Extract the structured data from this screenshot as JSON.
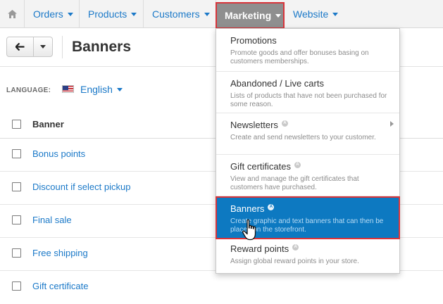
{
  "nav": {
    "items": [
      {
        "label": "Orders"
      },
      {
        "label": "Products"
      },
      {
        "label": "Customers"
      },
      {
        "label": "Marketing"
      },
      {
        "label": "Website"
      }
    ]
  },
  "toolbar": {
    "page_title": "Banners"
  },
  "language": {
    "label": "LANGUAGE:",
    "value": "English"
  },
  "table": {
    "column_header": "Banner",
    "rows": [
      {
        "label": "Bonus points"
      },
      {
        "label": "Discount if select pickup"
      },
      {
        "label": "Final sale"
      },
      {
        "label": "Free shipping"
      },
      {
        "label": "Gift certificate"
      }
    ]
  },
  "marketing_menu": {
    "items": [
      {
        "title": "Promotions",
        "description": "Promote goods and offer bonuses basing on customers memberships."
      },
      {
        "title": "Abandoned / Live carts",
        "description": "Lists of products that have not been purchased for some reason."
      },
      {
        "title": "Newsletters",
        "description": "Create and send newsletters to your customer."
      },
      {
        "title": "Gift certificates",
        "description": "View and manage the gift certificates that customers have purchased."
      },
      {
        "title": "Banners",
        "description": "Create graphic and text banners that can then be placed on the storefront."
      },
      {
        "title": "Reward points",
        "description": "Assign global reward points in your store."
      }
    ]
  },
  "colors": {
    "link": "#1b79c8",
    "active_menu": "#0d79c1",
    "highlight_border": "#d9343a"
  }
}
